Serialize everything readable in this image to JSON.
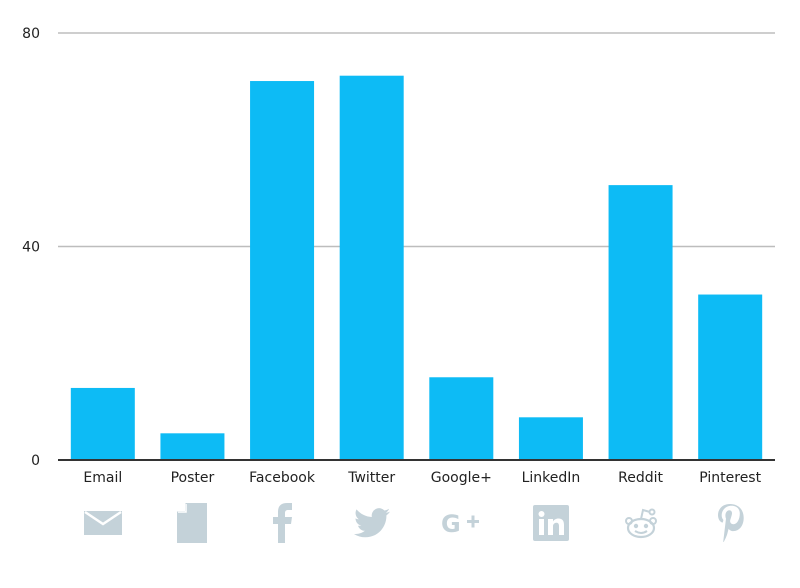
{
  "chart_data": {
    "type": "bar",
    "title": "",
    "xlabel": "",
    "ylabel": "",
    "categories": [
      "Email",
      "Poster",
      "Facebook",
      "Twitter",
      "Google+",
      "LinkedIn",
      "Reddit",
      "Pinterest"
    ],
    "values": [
      13.5,
      5,
      71,
      72,
      15.5,
      8,
      51.5,
      31
    ],
    "ylim": [
      0,
      80
    ],
    "yticks": [
      "0",
      "40",
      "80"
    ],
    "grid": true,
    "bar_color": "#0dbbf5",
    "icon_color": "#c4d2d9",
    "category_icons": [
      "envelope-icon",
      "document-icon",
      "facebook-icon",
      "twitter-icon",
      "google-plus-icon",
      "linkedin-icon",
      "reddit-icon",
      "pinterest-icon"
    ]
  }
}
